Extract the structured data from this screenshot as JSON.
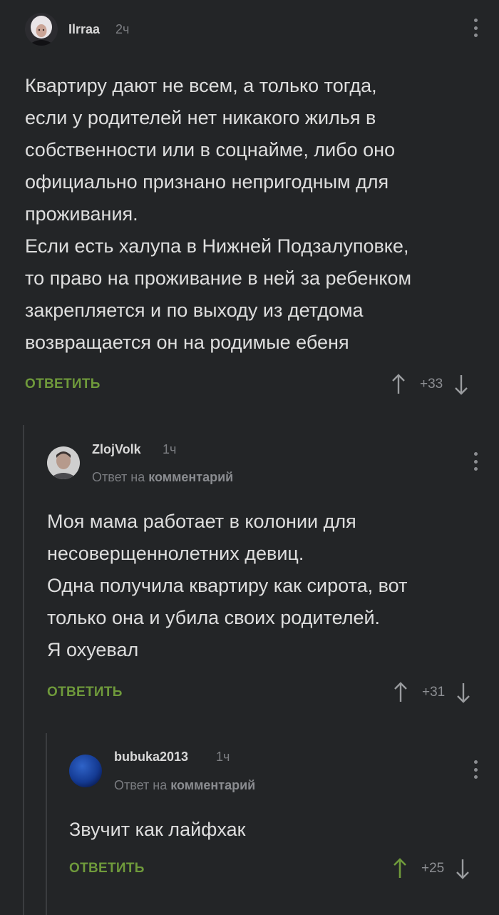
{
  "comments": [
    {
      "author": "Ilrraa",
      "time": "2ч",
      "reply_to_prefix": "",
      "reply_to_target": "",
      "text": "Квартиру дают не всем, а только тогда,\nесли у родителей нет никакого жилья в\nсобственности или в соцнайме, либо оно\nофициально признано непригодным для\nпроживания.\nЕсли есть халупа в Нижней Подзалуповке,\nто право на проживание в ней за ребенком\nзакрепляется и по выходу из детдома\nвозвращается он на родимые ебеня",
      "reply_label": "ОТВЕТИТЬ",
      "score": "+33",
      "upvoted": false,
      "avatar_icon": "user-avatar-photo"
    },
    {
      "author": "ZlojVolk",
      "time": "1ч",
      "reply_to_prefix": "Ответ на",
      "reply_to_target": "комментарий",
      "text": "Моя мама работает в колонии для\nнесоверщеннолетних девиц.\nОдна получила квартиру как сирота, вот\nтолько она и убила своих родителей.\nЯ охуевал",
      "reply_label": "ОТВЕТИТЬ",
      "score": "+31",
      "upvoted": false,
      "avatar_icon": "user-avatar-photo"
    },
    {
      "author": "bubuka2013",
      "time": "1ч",
      "reply_to_prefix": "Ответ на",
      "reply_to_target": "комментарий",
      "text": "Звучит как лайфхак",
      "reply_label": "ОТВЕТИТЬ",
      "score": "+25",
      "upvoted": true,
      "avatar_icon": "user-avatar-blue"
    }
  ],
  "colors": {
    "background": "#232527",
    "accent_green": "#6f9a3b",
    "thread_line": "#3b3d40",
    "muted_text": "#7d7f83"
  }
}
